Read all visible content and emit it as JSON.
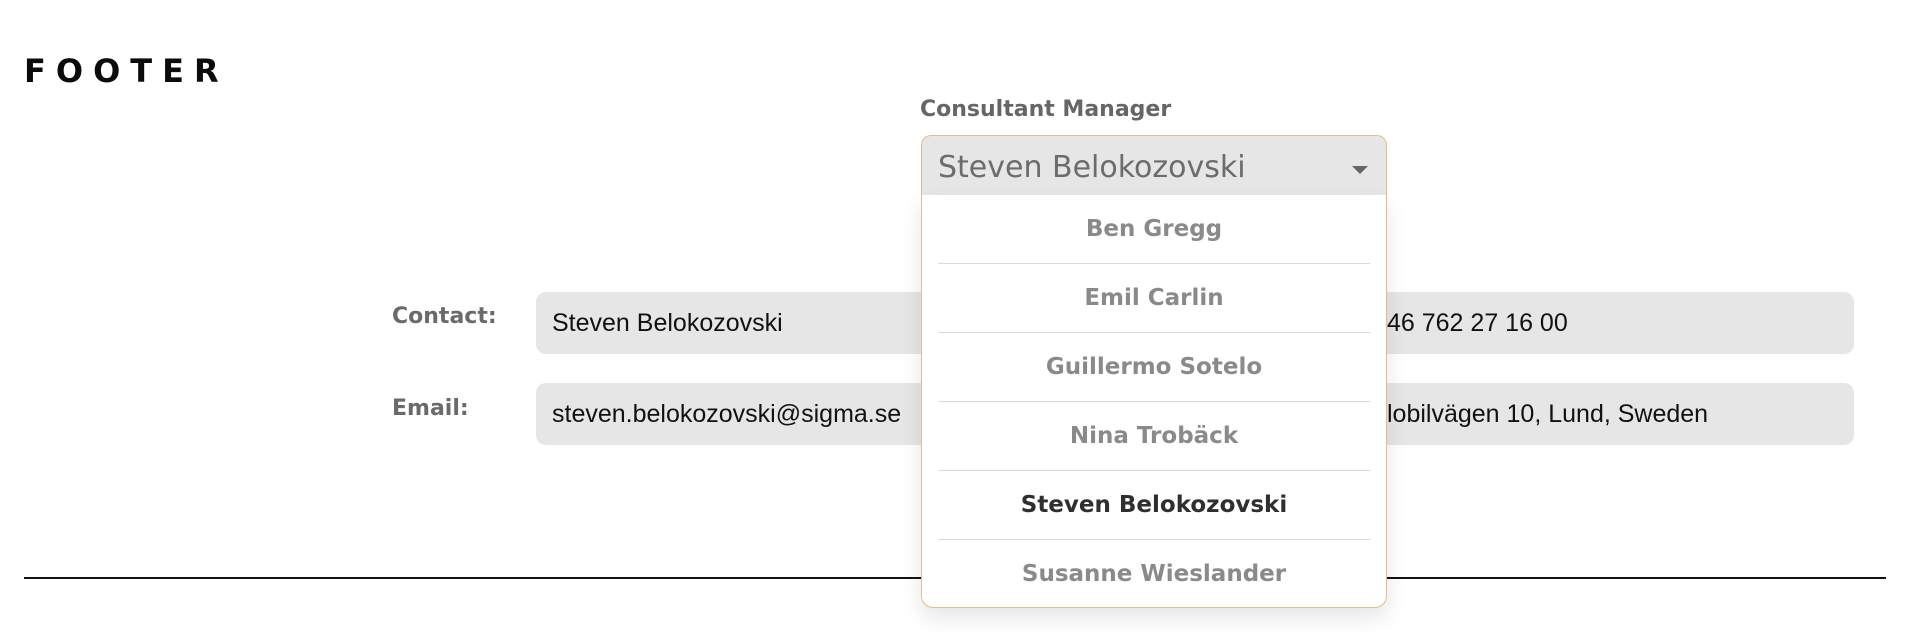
{
  "footer": {
    "title": "FOOTER"
  },
  "consultant_manager": {
    "label": "Consultant Manager",
    "selected": "Steven Belokozovski",
    "options": [
      "Ben Gregg",
      "Emil Carlin",
      "Guillermo Sotelo",
      "Nina Trobäck",
      "Steven Belokozovski",
      "Susanne Wieslander"
    ]
  },
  "contact": {
    "label": "Contact:",
    "value": "Steven Belokozovski",
    "phone_visible": "46 762 27 16 00"
  },
  "email": {
    "label": "Email:",
    "value": "steven.belokozovski@sigma.se",
    "address_visible": "lobilvägen 10, Lund, Sweden"
  }
}
